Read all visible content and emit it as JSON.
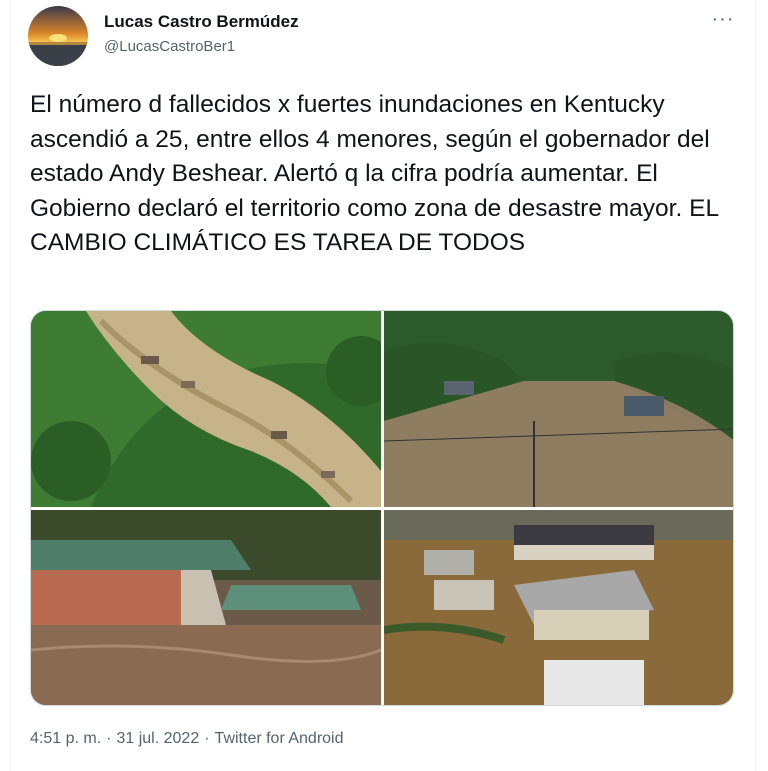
{
  "author": {
    "display_name": "Lucas Castro Bermúdez",
    "handle": "@LucasCastroBer1",
    "avatar_icon": "sunset-avatar-icon"
  },
  "menu": {
    "more_label": "···"
  },
  "tweet": {
    "text": "El número d fallecidos x fuertes inundaciones en Kentucky ascendió a 25, entre ellos 4 menores, según el gobernador del estado Andy Beshear. Alertó q la cifra podría aumentar. El Gobierno declaró el territorio como zona de desastre mayor. EL CAMBIO CLIMÁTICO ES TAREA DE TODOS"
  },
  "media": {
    "photos": [
      {
        "name": "flooded-valley-aerial-photo"
      },
      {
        "name": "flooded-town-aerial-photo"
      },
      {
        "name": "submerged-rooftops-photo"
      },
      {
        "name": "flooded-houses-aerial-photo"
      }
    ]
  },
  "footer": {
    "time": "4:51 p. m.",
    "separator": "·",
    "date": "31 jul. 2022",
    "source": "Twitter for Android"
  },
  "colors": {
    "text_primary": "#0f1419",
    "text_secondary": "#536471",
    "border": "#cfd9de"
  }
}
